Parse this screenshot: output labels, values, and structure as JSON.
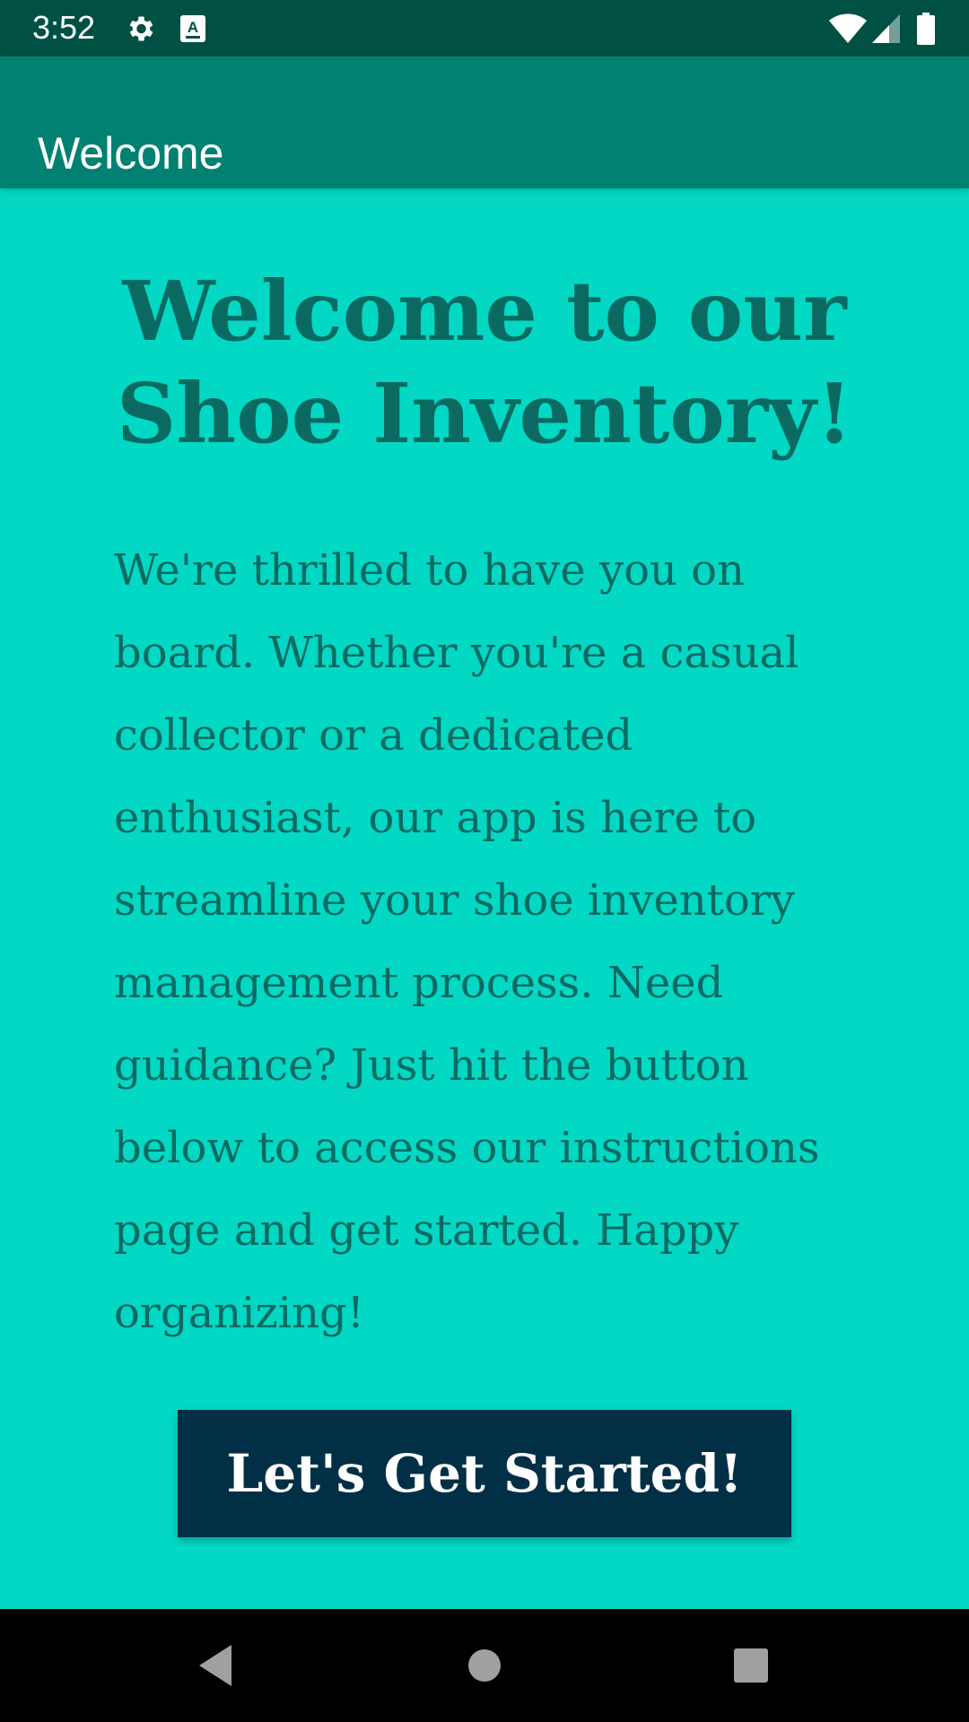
{
  "status_bar": {
    "time": "3:52",
    "icons": [
      "gear-icon",
      "accessibility-a-icon",
      "wifi-icon",
      "cellular-signal-icon",
      "battery-icon"
    ],
    "background_color": "#005044"
  },
  "app_bar": {
    "title": "Welcome",
    "background_color": "#008171"
  },
  "main": {
    "background_color": "#02d8c4",
    "headline": "Welcome to our Shoe Inventory!",
    "body": "We're thrilled to have you on board. Whether you're a casual collector or a dedicated enthusiast, our app is here to streamline your shoe inventory management process. Need guidance? Just hit the button below to access our instructions page and get started. Happy organizing!",
    "text_color": "#0a6a62",
    "button_label": "Let's Get Started!",
    "button_color": "#012f46"
  },
  "nav_bar": {
    "icons": [
      "back-icon",
      "home-icon",
      "recents-icon"
    ]
  }
}
